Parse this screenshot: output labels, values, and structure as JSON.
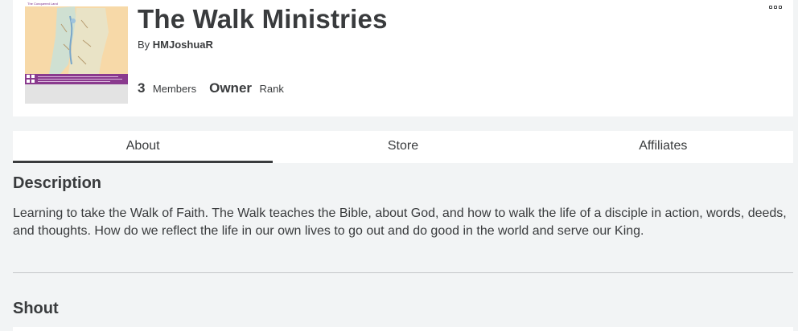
{
  "group": {
    "name": "The Walk Ministries",
    "owner_prefix": "By",
    "owner_name": "HMJoshuaR",
    "emblem": {
      "map_title": "The Conquered Land"
    },
    "stats": [
      {
        "value": "3",
        "label": "Members"
      },
      {
        "value": "Owner",
        "label": "Rank"
      }
    ]
  },
  "tabs": [
    {
      "label": "About",
      "active": true
    },
    {
      "label": "Store",
      "active": false
    },
    {
      "label": "Affiliates",
      "active": false
    }
  ],
  "about": {
    "description_title": "Description",
    "description_text": "Learning to take the Walk of Faith. The Walk teaches the Bible, about God, and how to walk the life of a disciple in action, words, deeds, and thoughts. How do we reflect the life in our own lives to go out and do good in the world and serve our King.",
    "shout_title": "Shout"
  },
  "colors": {
    "text": "#393b3d",
    "page_background": "#f2f4f5",
    "card_background": "#ffffff",
    "divider": "#c3c5c7"
  },
  "icons": {
    "more": "more-options-icon"
  }
}
